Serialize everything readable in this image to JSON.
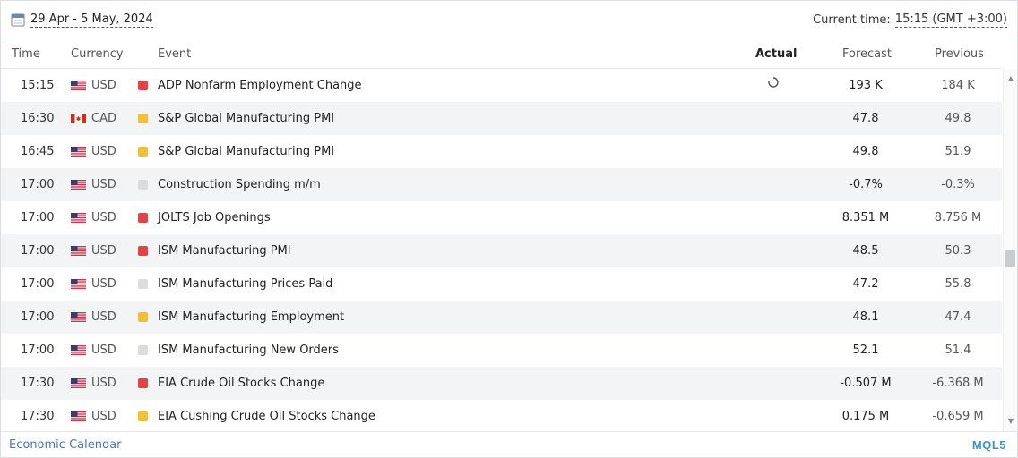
{
  "header": {
    "date_range": "29 Apr - 5 May, 2024",
    "current_time_label": "Current time:",
    "current_time_value": "15:15 (GMT +3:00)"
  },
  "columns": {
    "time": "Time",
    "currency": "Currency",
    "event": "Event",
    "actual": "Actual",
    "forecast": "Forecast",
    "previous": "Previous"
  },
  "rows": [
    {
      "time": "15:15",
      "currency": "USD",
      "flag": "us-flag",
      "importance": "high",
      "event": "ADP Nonfarm Employment Change",
      "actual_icon": "loading-icon",
      "forecast": "193 K",
      "previous": "184 K"
    },
    {
      "time": "16:30",
      "currency": "CAD",
      "flag": "ca-flag",
      "importance": "medium",
      "event": "S&P Global Manufacturing PMI",
      "forecast": "47.8",
      "previous": "49.8"
    },
    {
      "time": "16:45",
      "currency": "USD",
      "flag": "us-flag",
      "importance": "medium",
      "event": "S&P Global Manufacturing PMI",
      "forecast": "49.8",
      "previous": "51.9"
    },
    {
      "time": "17:00",
      "currency": "USD",
      "flag": "us-flag",
      "importance": "low",
      "event": "Construction Spending m/m",
      "forecast": "-0.7%",
      "previous": "-0.3%"
    },
    {
      "time": "17:00",
      "currency": "USD",
      "flag": "us-flag",
      "importance": "high",
      "event": "JOLTS Job Openings",
      "forecast": "8.351 M",
      "previous": "8.756 M"
    },
    {
      "time": "17:00",
      "currency": "USD",
      "flag": "us-flag",
      "importance": "high",
      "event": "ISM Manufacturing PMI",
      "forecast": "48.5",
      "previous": "50.3"
    },
    {
      "time": "17:00",
      "currency": "USD",
      "flag": "us-flag",
      "importance": "low",
      "event": "ISM Manufacturing Prices Paid",
      "forecast": "47.2",
      "previous": "55.8"
    },
    {
      "time": "17:00",
      "currency": "USD",
      "flag": "us-flag",
      "importance": "medium",
      "event": "ISM Manufacturing Employment",
      "forecast": "48.1",
      "previous": "47.4"
    },
    {
      "time": "17:00",
      "currency": "USD",
      "flag": "us-flag",
      "importance": "low",
      "event": "ISM Manufacturing New Orders",
      "forecast": "52.1",
      "previous": "51.4"
    },
    {
      "time": "17:30",
      "currency": "USD",
      "flag": "us-flag",
      "importance": "high",
      "event": "EIA Crude Oil Stocks Change",
      "forecast": "-0.507 M",
      "previous": "-6.368 M"
    },
    {
      "time": "17:30",
      "currency": "USD",
      "flag": "us-flag",
      "importance": "medium",
      "event": "EIA Cushing Crude Oil Stocks Change",
      "forecast": "0.175 M",
      "previous": "-0.659 M"
    }
  ],
  "colors": {
    "importance_high": "#e04444",
    "importance_medium": "#f2c037",
    "importance_low": "#dcdcdc",
    "row_alt": "#f2f4f6",
    "link": "#4a78b5",
    "brand": "#3a8fd6"
  },
  "footer": {
    "link_label": "Economic Calendar",
    "brand": "MQL5"
  }
}
